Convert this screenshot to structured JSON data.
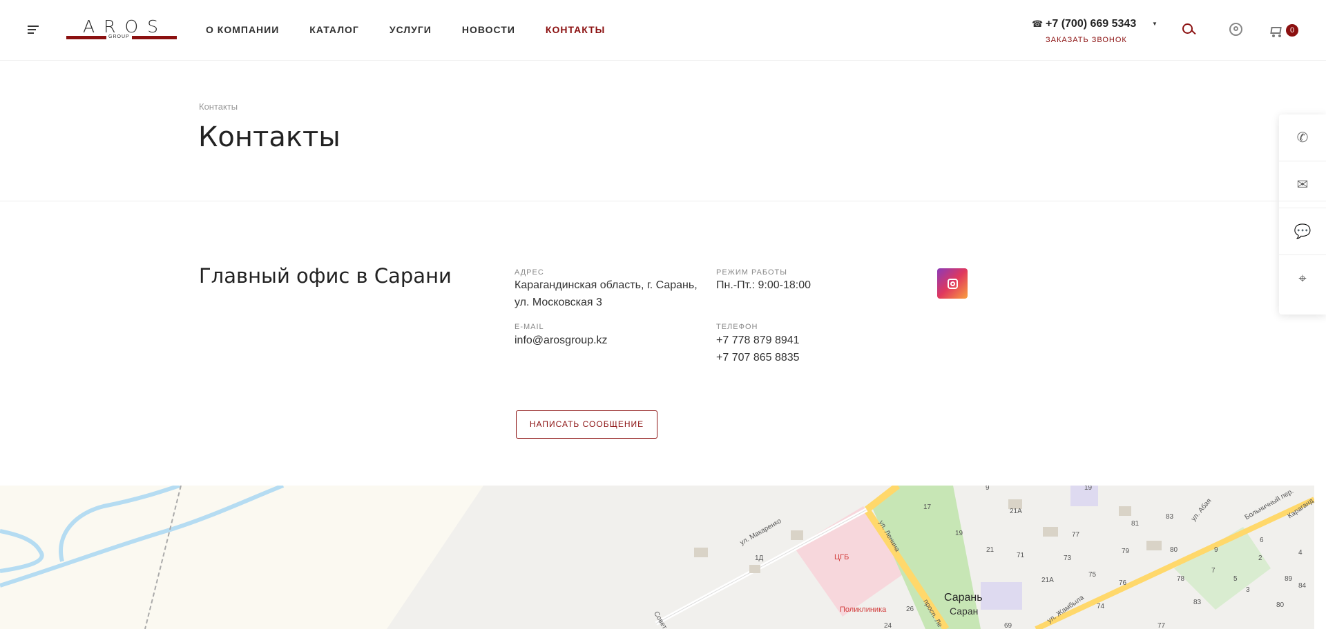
{
  "header": {
    "logo": {
      "main": "AROS",
      "sub": "GROUP"
    },
    "nav": [
      "О КОМПАНИИ",
      "КАТАЛОГ",
      "УСЛУГИ",
      "НОВОСТИ",
      "КОНТАКТЫ"
    ],
    "active_nav": "КОНТАКТЫ",
    "phone": "+7 (700) 669 5343",
    "callback": "ЗАКАЗАТЬ ЗВОНОК",
    "cart_count": "0"
  },
  "breadcrumb": "Контакты",
  "page_title": "Контакты",
  "office": {
    "title": "Главный офис в Сарани",
    "address_label": "АДРЕС",
    "address_line1": "Карагандинская область, г. Сарань,",
    "address_line2": "ул. Московская 3",
    "hours_label": "РЕЖИМ РАБОТЫ",
    "hours": "Пн.-Пт.: 9:00-18:00",
    "email_label": "E-MAIL",
    "email": "info@arosgroup.kz",
    "phone_label": "ТЕЛЕФОН",
    "phone1": "+7 778 879 8941",
    "phone2": "+7 707 865 8835",
    "button": "НАПИСАТЬ СООБЩЕНИЕ"
  },
  "map": {
    "streets": [
      "ул. Макаренко",
      "ул. Ленина",
      "просп. Ле",
      "ул. Жамбыла",
      "ул. Абая",
      "Больничный пер.",
      "Караганд",
      "Совет"
    ],
    "city": "Сарань",
    "city_sub": "Саран",
    "poi": [
      "ЦГБ",
      "Поликлиника"
    ],
    "house_numbers": [
      "9",
      "19",
      "17",
      "21А",
      "77",
      "81",
      "83",
      "19",
      "21",
      "71",
      "73",
      "79",
      "80",
      "9",
      "6",
      "2",
      "4",
      "1Д",
      "21А",
      "75",
      "76",
      "78",
      "7",
      "5",
      "3",
      "89",
      "84",
      "26",
      "24",
      "74",
      "83",
      "80",
      "69",
      "77"
    ],
    "colors": {
      "park": "#c7e6b5",
      "road": "#ffd86b",
      "water": "#b5dcf2",
      "hospital": "#f7d7dc"
    }
  }
}
